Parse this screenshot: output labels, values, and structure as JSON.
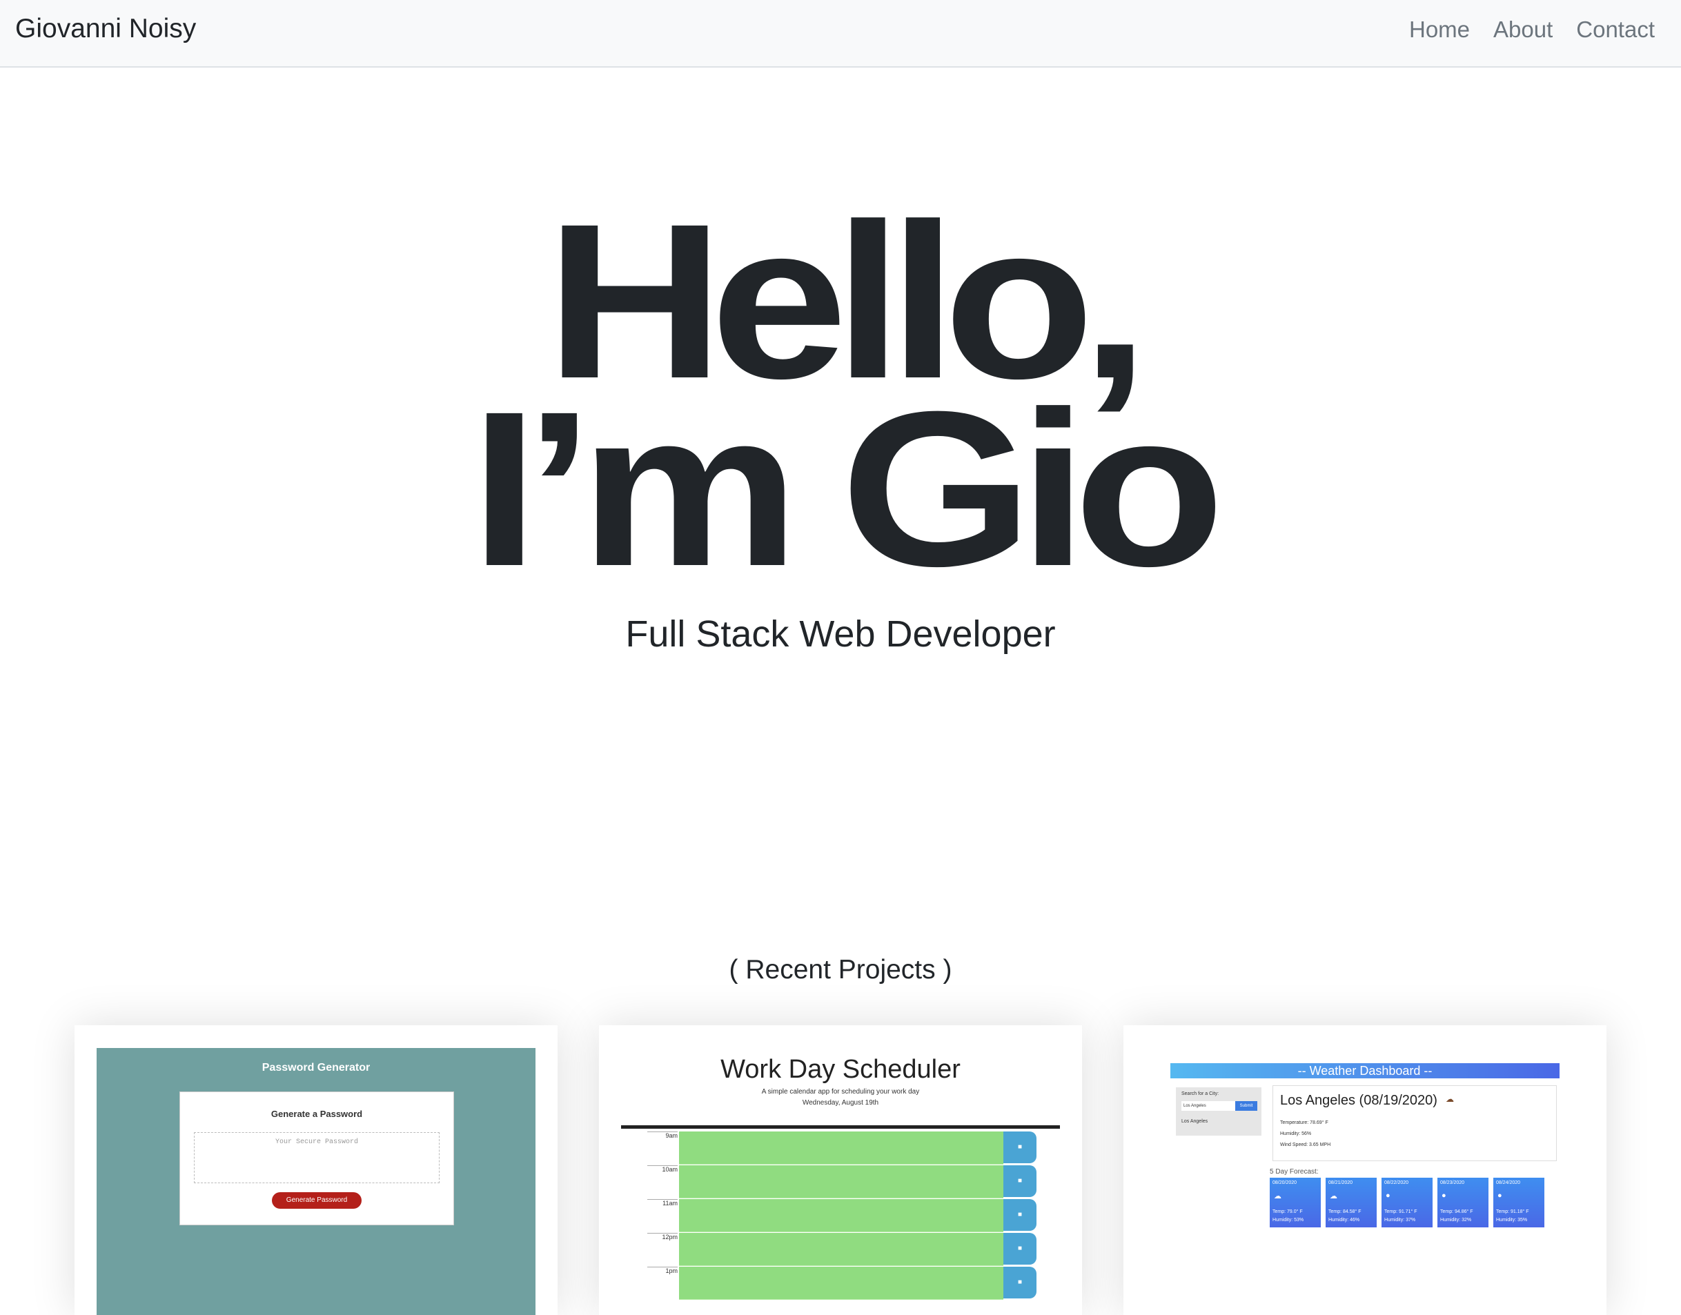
{
  "nav": {
    "brand": "Giovanni Noisy",
    "links": [
      "Home",
      "About",
      "Contact"
    ]
  },
  "hero": {
    "line1": "Hello,",
    "line2": "I’m Gio",
    "subtitle": "Full Stack Web Developer"
  },
  "projects": {
    "heading": "( Recent Projects )",
    "password_generator": {
      "title": "Password Generator",
      "box_heading": "Generate a Password",
      "placeholder": "Your Secure Password",
      "button": "Generate Password"
    },
    "scheduler": {
      "title": "Work Day Scheduler",
      "subtitle": "A simple calendar app for scheduling your work day",
      "date": "Wednesday, August 19th",
      "hours": [
        "9am",
        "10am",
        "11am",
        "12pm",
        "1pm"
      ]
    },
    "weather": {
      "header": "-- Weather Dashboard --",
      "search_label": "Search for a City:",
      "search_value": "Los Angeles",
      "submit": "Submit",
      "history_city": "Los Angeles",
      "current_title": "Los Angeles (08/19/2020)",
      "temperature": "Temperature: 78.69° F",
      "humidity": "Humidity: 56%",
      "wind": "Wind Speed: 3.65 MPH",
      "forecast_label": "5 Day Forecast:",
      "forecast": [
        {
          "date": "08/20/2020",
          "temp": "Temp: 79.0° F",
          "humidity": "Humidity: 53%"
        },
        {
          "date": "08/21/2020",
          "temp": "Temp: 84.58° F",
          "humidity": "Humidity: 46%"
        },
        {
          "date": "08/22/2020",
          "temp": "Temp: 91.71° F",
          "humidity": "Humidity: 37%"
        },
        {
          "date": "08/23/2020",
          "temp": "Temp: 94.86° F",
          "humidity": "Humidity: 32%"
        },
        {
          "date": "08/24/2020",
          "temp": "Temp: 91.18° F",
          "humidity": "Humidity: 35%"
        }
      ]
    }
  }
}
